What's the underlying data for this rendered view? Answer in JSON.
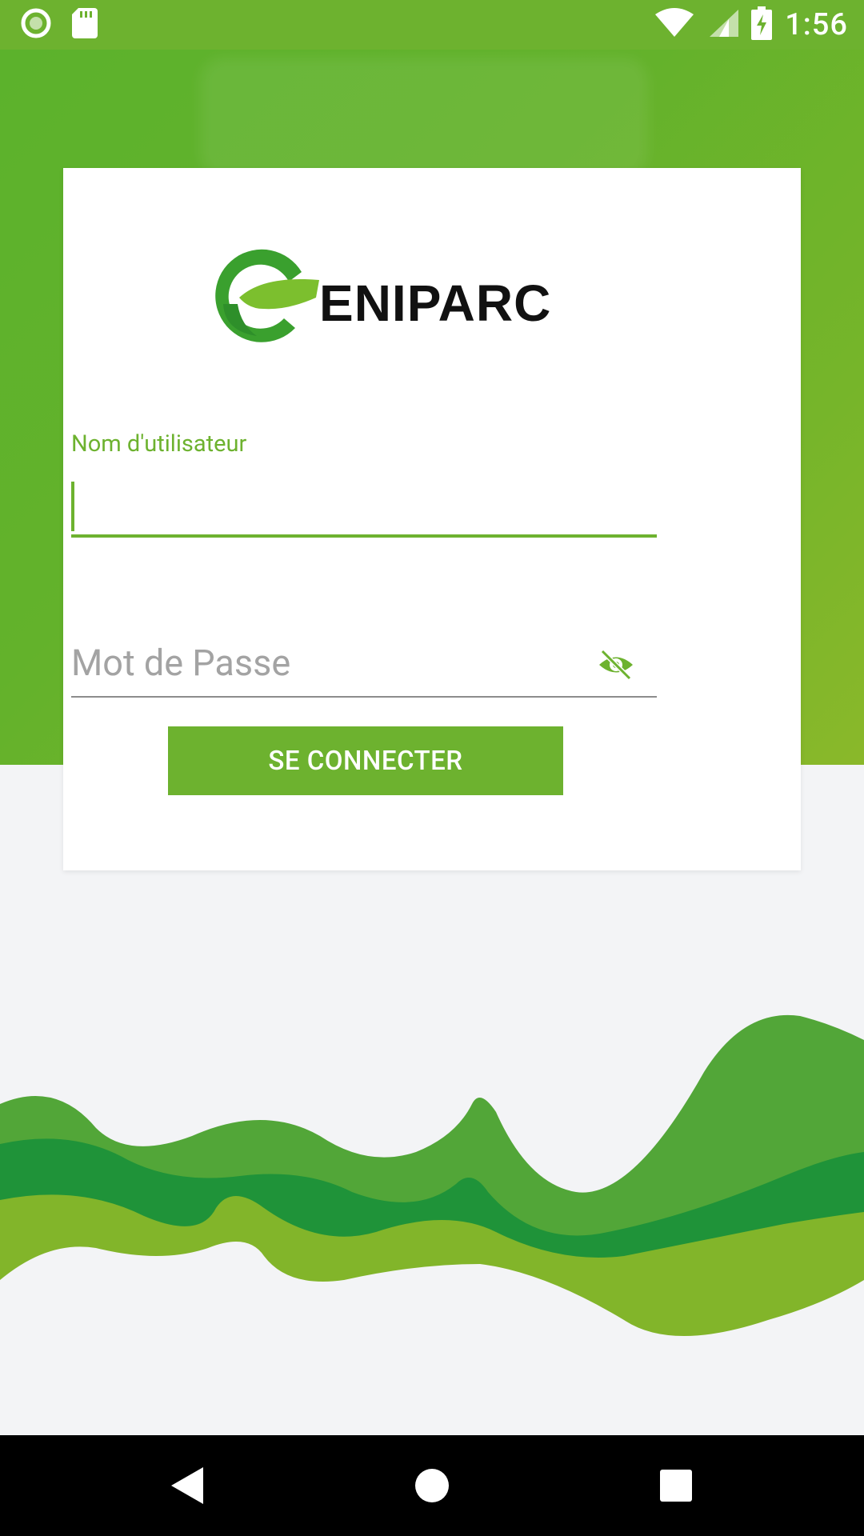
{
  "status_bar": {
    "time": "1:56",
    "icons": [
      "notification-circle-icon",
      "sd-card-icon",
      "wifi-icon",
      "signal-icon",
      "battery-charging-icon"
    ]
  },
  "login": {
    "logo_text": "ENIPARC",
    "username_label": "Nom d'utilisateur",
    "username_value": "",
    "password_placeholder": "Mot de Passe",
    "password_toggle_icon": "visibility-off-icon",
    "submit_label": "SE CONNECTER"
  },
  "nav_bar": {
    "icons": [
      "back-icon",
      "home-icon",
      "recents-icon"
    ]
  },
  "colors": {
    "accent": "#6db22f",
    "card": "#ffffff",
    "background": "#f3f4f6"
  }
}
